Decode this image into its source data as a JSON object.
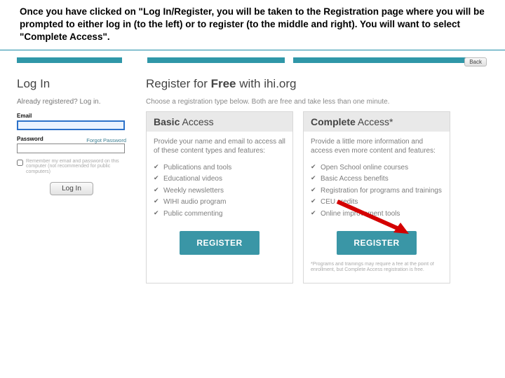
{
  "instruction": "Once you have clicked on \"Log In/Register, you will be taken to the Registration page where you will be prompted to either log in (to the left) or to register (to the middle and right). You will want to select \"Complete Access\".",
  "back": "Back",
  "login": {
    "title": "Log In",
    "sub": "Already registered? Log in.",
    "email_label": "Email",
    "password_label": "Password",
    "forgot": "Forgot Password",
    "remember": "Remember my email and password on this computer (not recommended for public computers)",
    "button": "Log In"
  },
  "register": {
    "title_pre": "Register for ",
    "title_bold": "Free",
    "title_post": " with ihi.org",
    "sub": "Choose a registration type below. Both are free and take less than one minute.",
    "basic": {
      "head_bold": "Basic",
      "head_rest": " Access",
      "blurb": "Provide your name and email to access all of these content types and features:",
      "features": [
        "Publications and tools",
        "Educational videos",
        "Weekly newsletters",
        "WIHI audio program",
        "Public commenting"
      ],
      "button": "REGISTER"
    },
    "complete": {
      "head_bold": "Complete",
      "head_rest": " Access*",
      "blurb": "Provide a little more information and access even more content and features:",
      "features": [
        "Open School online courses",
        "Basic Access benefits",
        "Registration for programs and trainings",
        "CEU credits",
        "Online improvement tools"
      ],
      "button": "REGISTER",
      "fine": "*Programs and trainings may require a fee at the point of enrollment, but Complete Access registration is free."
    }
  }
}
